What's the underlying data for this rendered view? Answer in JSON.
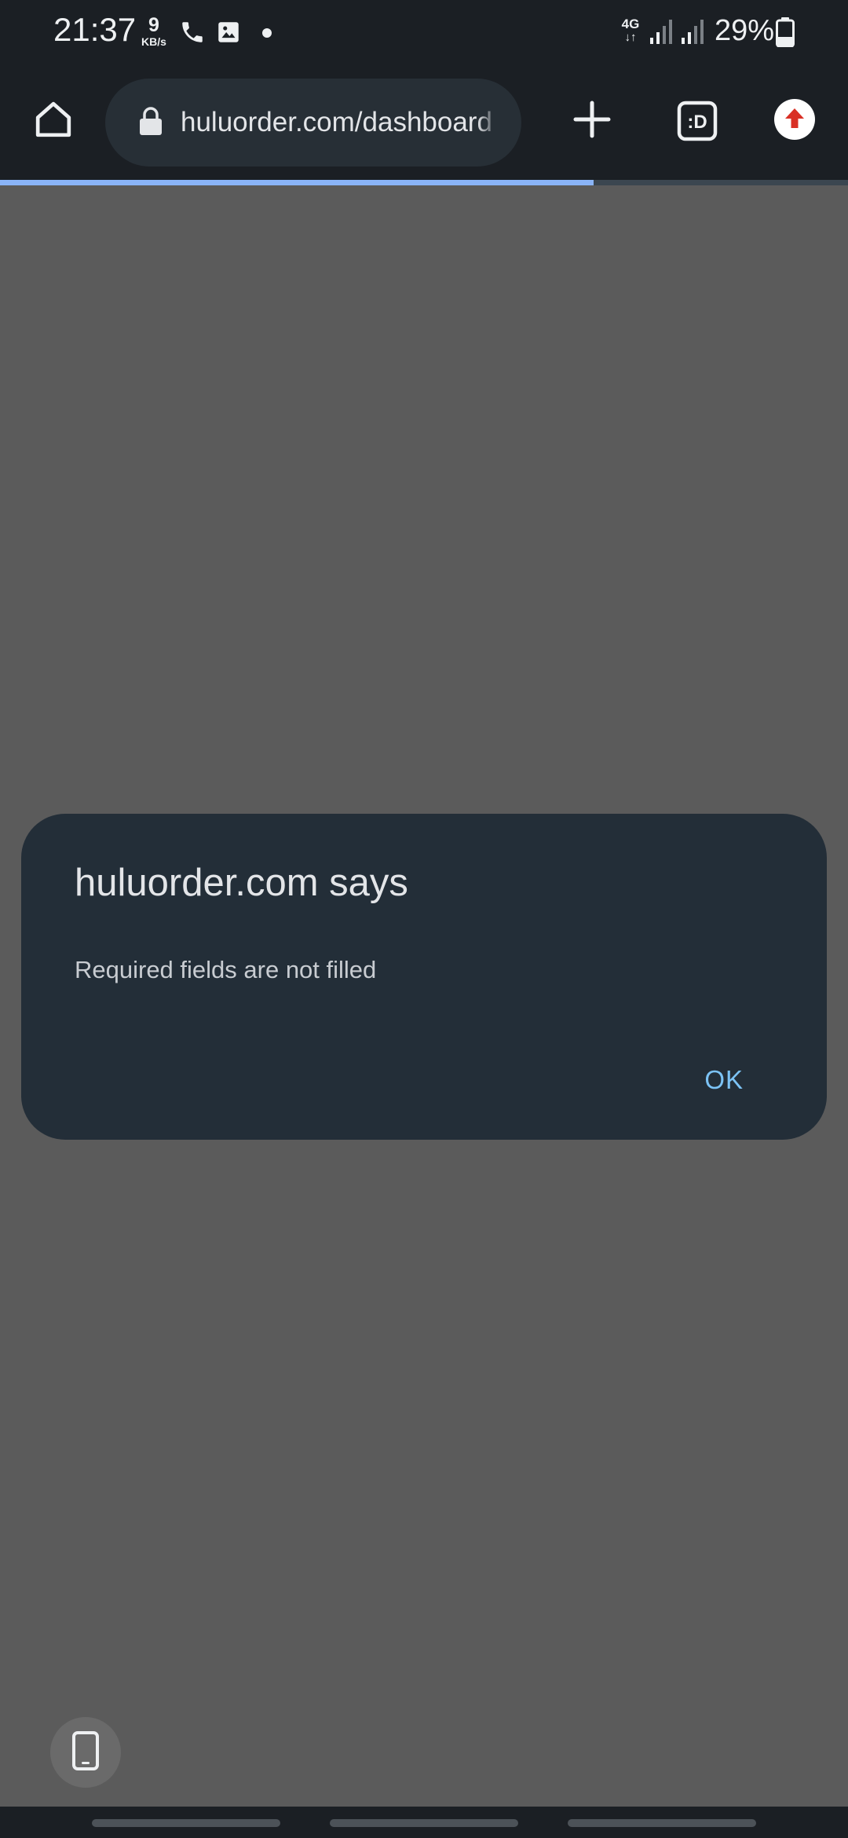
{
  "status_bar": {
    "time": "21:37",
    "net_speed_value": "9",
    "net_speed_unit": "KB/s",
    "network_type": "4G",
    "network_arrows": "↓↑",
    "battery_percent": "29%",
    "icons": [
      "phone-icon",
      "image-icon",
      "notification-dot",
      "signal-icon",
      "signal-icon",
      "battery-icon"
    ]
  },
  "toolbar": {
    "url": "huluorder.com/dashboard",
    "tab_switcher_label": ":D",
    "icons": [
      "home-icon",
      "lock-icon",
      "new-tab-icon",
      "tab-switcher-icon",
      "update-icon"
    ]
  },
  "page_load": {
    "progress": 0.7,
    "accent_color": "#8ab4f8"
  },
  "dialog": {
    "title": "huluorder.com says",
    "message": "Required fields are not filled",
    "ok_label": "OK"
  },
  "floating": {
    "icon": "phone-device-icon"
  }
}
